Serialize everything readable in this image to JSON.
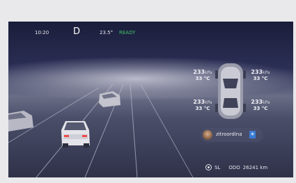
{
  "status_bar": {
    "time": "10:20",
    "gear": "D",
    "outside_temp": "23.5°",
    "drive_status": "READY",
    "drive_status_color": "#3ec46a"
  },
  "tires": {
    "front_left": {
      "pressure": "233",
      "pressure_unit": "kPa",
      "temp": "33 °C"
    },
    "front_right": {
      "pressure": "233",
      "pressure_unit": "kPa",
      "temp": "33 °C"
    },
    "rear_left": {
      "pressure": "233",
      "pressure_unit": "kPa",
      "temp": "33 °C"
    },
    "rear_right": {
      "pressure": "233",
      "pressure_unit": "kPa",
      "temp": "33 °C"
    }
  },
  "user": {
    "name": "zitroordina",
    "bluetooth_icon": "bluetooth-icon"
  },
  "bottom_bar": {
    "range": "SL",
    "odo_label": "ODO",
    "odo_value": "26241 km"
  }
}
